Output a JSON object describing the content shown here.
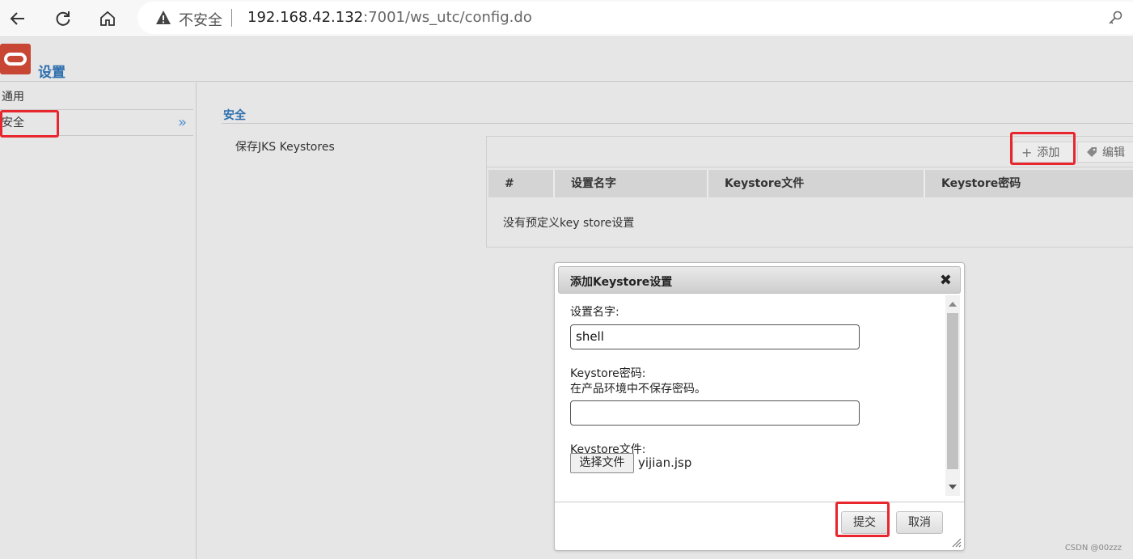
{
  "browser": {
    "back": "back-arrow",
    "reload": "reload",
    "home": "home",
    "insecure_label": "不安全",
    "url_host": "192.168.42.132",
    "url_path": ":7001/ws_utc/config.do"
  },
  "header": {
    "title": "设置"
  },
  "sidebar": {
    "items": [
      {
        "label": "通用"
      },
      {
        "label": "安全",
        "arrow": "»"
      }
    ]
  },
  "main": {
    "section_title": "安全",
    "field_label": "保存JKS Keystores",
    "toolbar": {
      "add_label": "添加",
      "edit_label": "编辑"
    },
    "table": {
      "columns": [
        "#",
        "设置名字",
        "Keystore文件",
        "Keystore密码"
      ],
      "empty_text": "没有预定义key store设置"
    }
  },
  "dialog": {
    "title": "添加Keystore设置",
    "close": "✖",
    "name_label": "设置名字:",
    "name_value": "shell",
    "password_label": "Keystore密码:",
    "password_hint": "在产品环境中不保存密码。",
    "password_value": "",
    "file_label": "Keystore文件:",
    "file_button": "选择文件",
    "file_name": "yijian.jsp",
    "submit_label": "提交",
    "cancel_label": "取消"
  },
  "watermark": "CSDN @00zzz",
  "colors": {
    "accent": "#2e6fae",
    "highlight": "#e8262d",
    "logo": "#c74634"
  }
}
